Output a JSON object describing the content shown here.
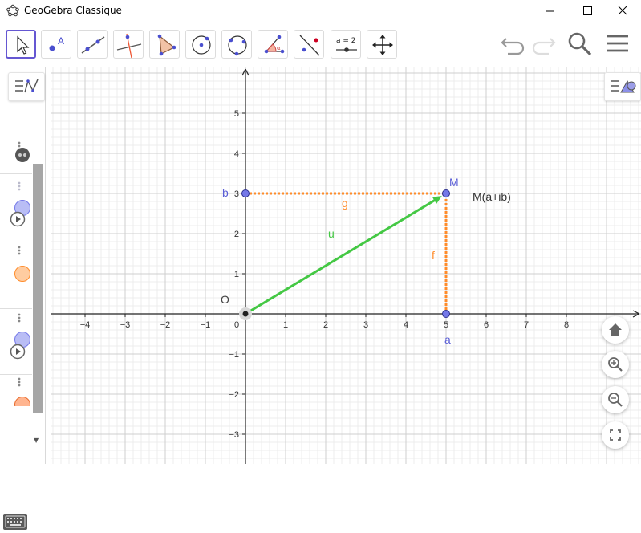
{
  "window": {
    "title": "GeoGebra Classique"
  },
  "toolbar": {
    "tools": [
      "move",
      "point",
      "line",
      "perpendicular-line",
      "polygon",
      "circle-center-point",
      "circle-three-points",
      "angle",
      "reflect",
      "slider",
      "move-graphics-view"
    ],
    "slider_label": "a = 2"
  },
  "graph": {
    "x_ticks": [
      "−4",
      "−3",
      "−2",
      "−1",
      "0",
      "1",
      "2",
      "3",
      "4",
      "5",
      "6",
      "7",
      "8"
    ],
    "y_ticks": [
      "5",
      "4",
      "3",
      "2",
      "1",
      "−1",
      "−2",
      "−3"
    ],
    "labels": {
      "origin": "O",
      "point_M": "M",
      "M_text": "M(a+ib)",
      "point_b": "b",
      "point_a": "a",
      "segment_g": "g",
      "segment_f": "f",
      "vector_u": "u"
    },
    "points": {
      "O": [
        0,
        0
      ],
      "M": [
        5,
        3
      ],
      "a": [
        5,
        0
      ],
      "b": [
        0,
        3
      ]
    },
    "colors": {
      "point": "#7478e8",
      "segment": "#ff8c2b",
      "vector": "#44c844",
      "label_point": "#5b5fd6"
    }
  },
  "algebra": {
    "item_colors": [
      "#505050",
      "#b9bdf5",
      "#ffcca0",
      "#b9bdf5",
      "#ffb590"
    ]
  }
}
